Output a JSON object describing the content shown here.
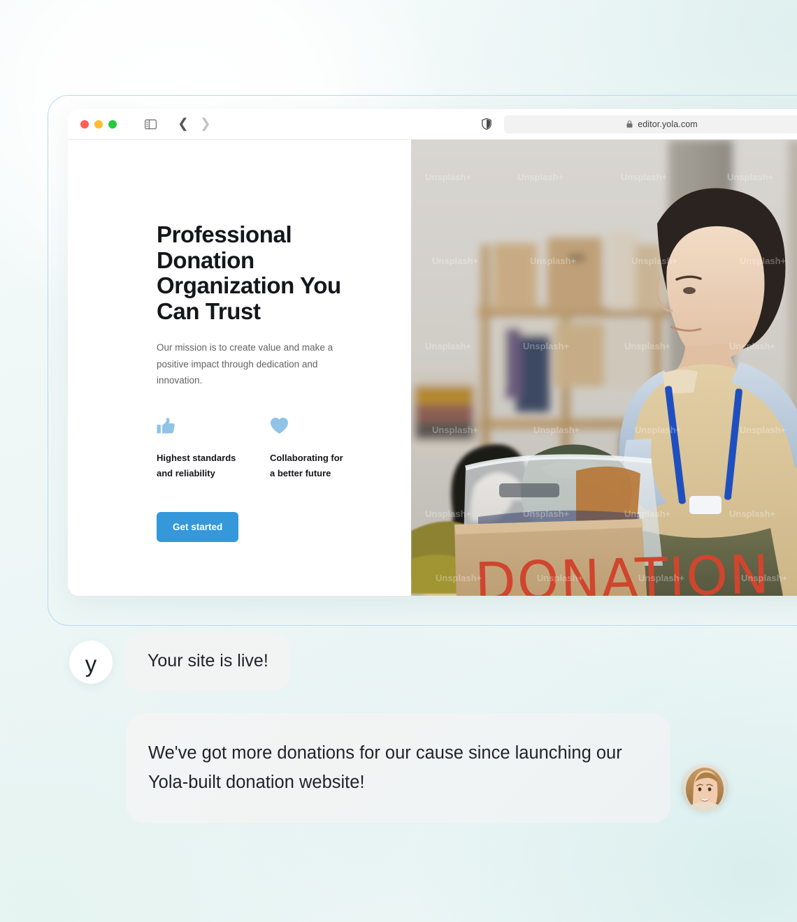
{
  "background": {
    "accent_border": "#b7dced",
    "tint": "#e8f4f3"
  },
  "browser": {
    "traffic_lights": [
      "close-red",
      "minimize-yellow",
      "maximize-green"
    ],
    "sidebar_toggle_icon": "sidebar-toggle-icon",
    "back_icon": "chevron-left-icon",
    "forward_icon": "chevron-right-icon",
    "shield_icon": "shield-icon",
    "lock_icon": "lock-icon",
    "reload_icon": "reload-icon",
    "url": "editor.yola.com"
  },
  "site": {
    "hero": {
      "title": "Professional Donation Organization You Can Trust",
      "subtitle": "Our mission is to create value and make a positive impact through dedication and innovation.",
      "cta_label": "Get started",
      "cta_color": "#3498db"
    },
    "features": [
      {
        "icon": "thumbs-up-icon",
        "label": "Highest standards\nand reliability",
        "color": "#8fc3e8"
      },
      {
        "icon": "heart-icon",
        "label": "Collaborating for\na better future",
        "color": "#8fc3e8"
      }
    ],
    "photo": {
      "alt": "Two volunteers with blue lanyards sorting clothing donations at a table",
      "box_sign_text": "DONATION",
      "watermarks": [
        "Unsplash+",
        "Unsplash+",
        "Unsplash+",
        "Unsplash+",
        "Unsplash+",
        "Unsplash+",
        "Unsplash+",
        "Unsplash+",
        "Unsplash+"
      ]
    }
  },
  "chat": {
    "messages": [
      {
        "avatar": "yola-logo-avatar",
        "avatar_letter": "y",
        "text": "Your site is live!"
      },
      {
        "avatar": "user-photo-avatar",
        "text": "We've got more donations for our cause since launching our Yola-built donation website!"
      }
    ]
  }
}
